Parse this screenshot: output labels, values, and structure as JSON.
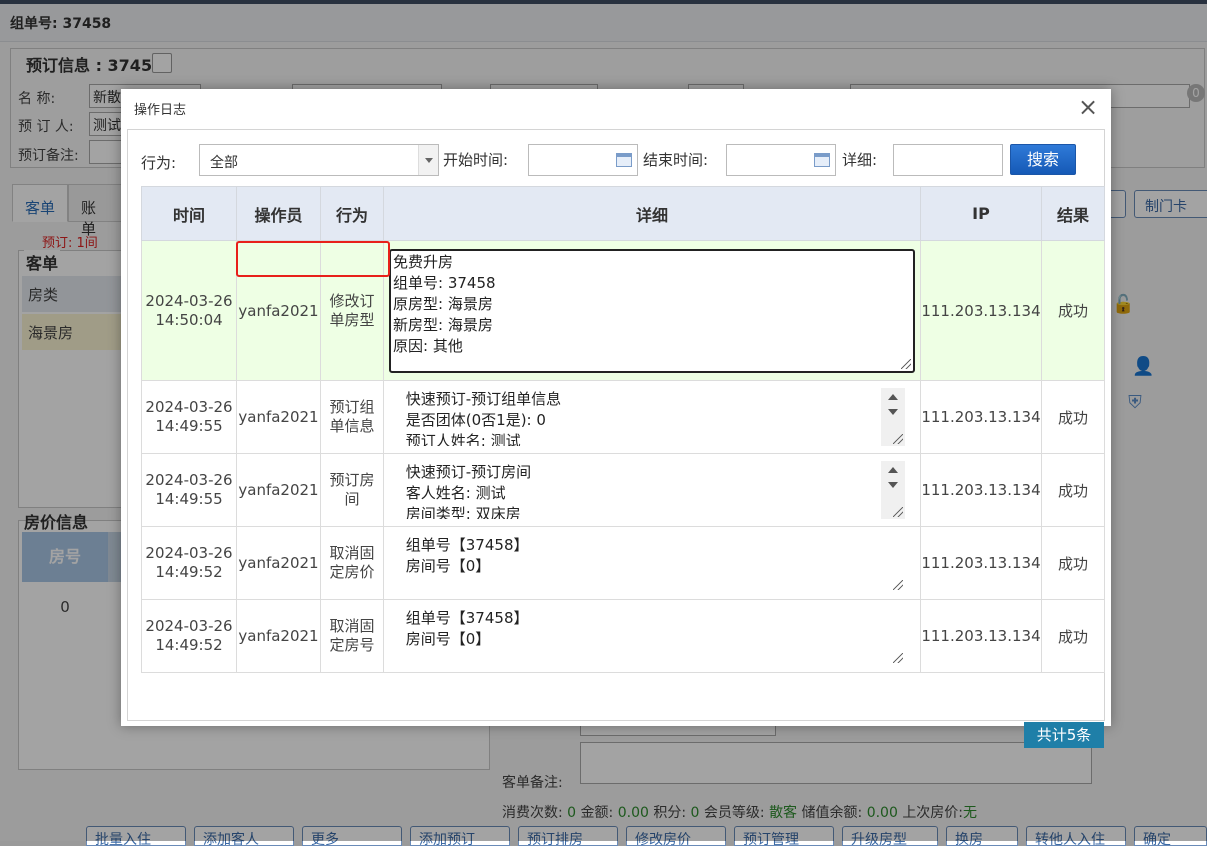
{
  "background": {
    "header_title": "组单号: 37458",
    "legend": "预订信息 : 37458",
    "fields": {
      "name_label": "名    称:",
      "name_value": "新散",
      "booker_label": "预 订 人:",
      "booker_value": "测试",
      "remark_label": "预订备注:"
    },
    "badge": "0",
    "tabs": [
      "客单",
      "账单"
    ],
    "red_note": "预订: 1间",
    "guest_panel_title": "客单",
    "guest_head": "房类",
    "guest_row": "海景房",
    "price_title": "房价信息",
    "price_head": "房号",
    "price_value": "0",
    "right_button": "制门卡",
    "bottom": {
      "remark_label": "客单备注:",
      "stats_consume_label": "消费次数:",
      "stats_consume": "0",
      "stats_amount_label": "金额:",
      "stats_amount": "0.00",
      "stats_points_label": "积分:",
      "stats_points": "0",
      "stats_level_label": "会员等级:",
      "stats_level": "散客",
      "stats_balance_label": "储值余额:",
      "stats_balance": "0.00",
      "stats_last_label": "上次房价:",
      "stats_last": "无"
    },
    "buttons": [
      "批量入住",
      "添加客人",
      "更多",
      "添加预订",
      "预订排房",
      "修改房价",
      "预订管理",
      "升级房型",
      "换房",
      "转他人入住",
      "确定"
    ]
  },
  "modal": {
    "title": "操作日志",
    "close": "×",
    "filters": {
      "action_label": "行为:",
      "action_value": "全部",
      "start_label": "开始时间:",
      "end_label": "结束时间:",
      "detail_label": "详细:",
      "search_button": "搜索"
    },
    "columns": [
      "时间",
      "操作员",
      "行为",
      "详细",
      "IP",
      "结果"
    ],
    "rows": [
      {
        "date": "2024-03-26",
        "time": "14:50:04",
        "operator": "yanfa2021",
        "action_1": "修改订",
        "action_2": "单房型",
        "detail": "免费升房\n组单号: 37458\n原房型: 海景房\n新房型: 海景房\n原因: 其他",
        "ip": "111.203.13.134",
        "result": "成功"
      },
      {
        "date": "2024-03-26",
        "time": "14:49:55",
        "operator": "yanfa2021",
        "action_1": "预订组",
        "action_2": "单信息",
        "detail": " 快速预订-预订组单信息\n 是否团体(0否1是): 0\n 预订人姓名: 测试",
        "ip": "111.203.13.134",
        "result": "成功"
      },
      {
        "date": "2024-03-26",
        "time": "14:49:55",
        "operator": "yanfa2021",
        "action_1": "预订房",
        "action_2": "间",
        "detail": " 快速预订-预订房间\n 客人姓名: 测试\n 房间类型: 双床房",
        "ip": "111.203.13.134",
        "result": "成功"
      },
      {
        "date": "2024-03-26",
        "time": "14:49:52",
        "operator": "yanfa2021",
        "action_1": "取消固",
        "action_2": "定房价",
        "detail": " 组单号【37458】\n 房间号【0】",
        "ip": "111.203.13.134",
        "result": "成功"
      },
      {
        "date": "2024-03-26",
        "time": "14:49:52",
        "operator": "yanfa2021",
        "action_1": "取消固",
        "action_2": "定房号",
        "detail": " 组单号【37458】\n 房间号【0】",
        "ip": "111.203.13.134",
        "result": "成功"
      }
    ],
    "total": "共计5条"
  }
}
